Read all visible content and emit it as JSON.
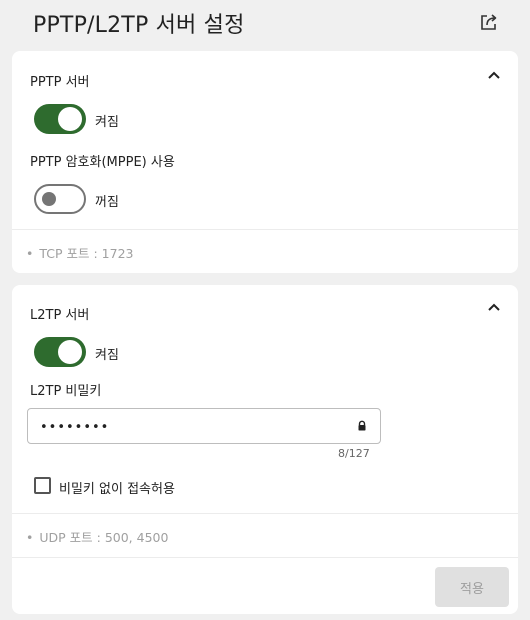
{
  "header": {
    "title": "PPTP/L2TP 서버 설정"
  },
  "pptp": {
    "section_title": "PPTP 서버",
    "server_toggle": {
      "state": "켜짐",
      "on": true
    },
    "encryption_label": "PPTP 암호화(MPPE) 사용",
    "encryption_toggle": {
      "state": "꺼짐",
      "on": false
    },
    "port_info": "TCP 포트 : 1723"
  },
  "l2tp": {
    "section_title": "L2TP 서버",
    "server_toggle": {
      "state": "켜짐",
      "on": true
    },
    "secret_label": "L2TP 비밀키",
    "secret_value": "••••••••",
    "secret_count": "8/127",
    "no_secret_label": "비밀키 없이 접속허용",
    "no_secret_checked": false,
    "port_info": "UDP 포트 : 500, 4500",
    "apply_label": "적용"
  },
  "colors": {
    "toggle_on": "#2e6b2e",
    "toggle_off_border": "#757575",
    "disabled_button_bg": "#e0e0e0",
    "disabled_button_text": "#9e9e9e"
  },
  "icons": {
    "export": "export-icon",
    "collapse": "chevron-up-icon",
    "lock": "lock-icon"
  }
}
